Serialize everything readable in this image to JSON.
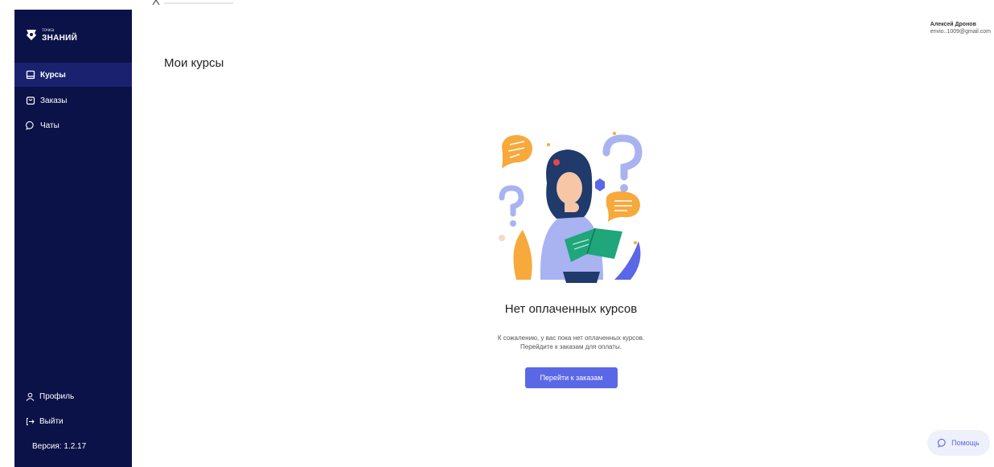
{
  "app": {
    "logo_small": "точка",
    "logo_big": "ЗНАНИЙ"
  },
  "sidebar": {
    "items": [
      {
        "label": "Курсы",
        "icon": "book-icon",
        "active": true
      },
      {
        "label": "Заказы",
        "icon": "bag-icon",
        "active": false
      },
      {
        "label": "Чаты",
        "icon": "chat-icon",
        "active": false
      }
    ],
    "profile_label": "Профиль",
    "logout_label": "Выйти",
    "version_label": "Версия: 1.2.17"
  },
  "header": {
    "user_name": "Алексей Дронов",
    "user_email": "envio..1009@gmail.com"
  },
  "main": {
    "title": "Мои курсы",
    "empty_title": "Нет оплаченных курсов",
    "empty_desc_line1": "К сожалению, у вас пока нет оплаченных курсов.",
    "empty_desc_line2": "Перейдите к заказам для оплаты.",
    "cta_label": "Перейти к заказам"
  },
  "help": {
    "label": "Помощь"
  },
  "colors": {
    "sidebar_bg": "#0b1248",
    "sidebar_active": "#1a2270",
    "accent": "#5a67e6",
    "illustration_orange": "#f7a93b",
    "illustration_purple": "#a9b3f2",
    "illustration_green": "#1fa67a"
  }
}
